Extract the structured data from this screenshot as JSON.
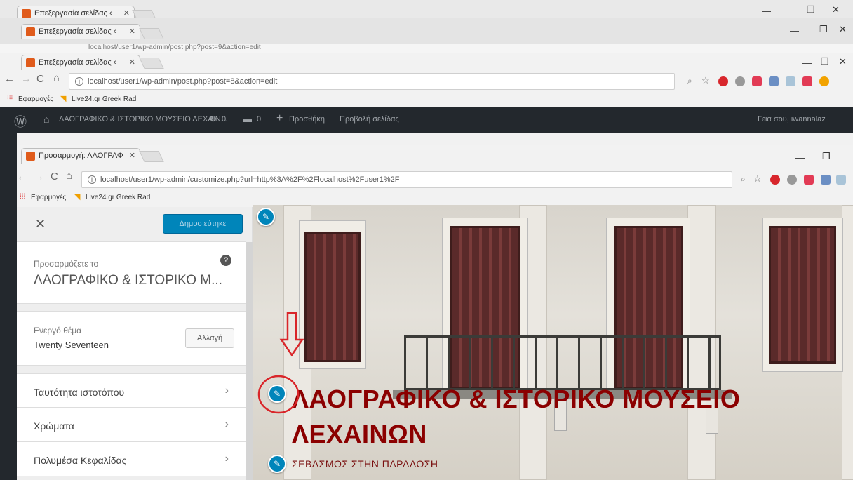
{
  "window_back2": {
    "tab_title": "Επεξεργασία σελίδας ‹",
    "address": "localhost/user1/wp-admin/post.php?post=9&action=edit"
  },
  "window_back1": {
    "tab_title": "Επεξεργασία σελίδας ‹"
  },
  "window_edit": {
    "tab_title": "Επεξεργασία σελίδας ‹",
    "address": "localhost/user1/wp-admin/post.php?post=8&action=edit",
    "bookmarks": {
      "apps": "Εφαρμογές",
      "live24": "Live24.gr Greek Rad"
    }
  },
  "wp_admin_bar": {
    "site_name": "ΛΑΟΓΡΑΦΙΚΟ & ΙΣΤΟΡΙΚΟ ΜΟΥΣΕΙΟ ΛΕΧΑΙΝ...",
    "updates_count": "0",
    "comments_count": "0",
    "new_label": "Προσθήκη",
    "view_label": "Προβολή σελίδας",
    "greeting": "Γεια σου, iwannalaz"
  },
  "window_customize": {
    "tab_title": "Προσαρμογή: ΛΑΟΓΡΑΦ",
    "address": "localhost/user1/wp-admin/customize.php?url=http%3A%2F%2Flocalhost%2Fuser1%2F",
    "bookmarks": {
      "apps": "Εφαρμογές",
      "live24": "Live24.gr Greek Rad"
    }
  },
  "customizer": {
    "publish_label": "Δημοσιεύτηκε",
    "customizing_label": "Προσαρμόζετε το",
    "site_title": "ΛΑΟΓΡΑΦΙΚΟ & ΙΣΤΟΡΙΚΟ Μ...",
    "active_theme_label": "Ενεργό θέμα",
    "theme_name": "Twenty Seventeen",
    "change_button": "Αλλαγή",
    "menu_items": [
      {
        "label": "Ταυτότητα ιστοτόπου"
      },
      {
        "label": "Χρώματα"
      },
      {
        "label": "Πολυμέσα Κεφαλίδας"
      }
    ]
  },
  "preview": {
    "site_title_line1": "ΛΑΟΓΡΑΦΙΚΟ & ΙΣΤΟΡΙΚΟ ΜΟΥΣΕΙΟ",
    "site_title_line2": "ΛΕΧΑΙΝΩΝ",
    "tagline": "ΣΕΒΑΣΜΟΣ ΣΤΗΝ ΠΑΡΑΔΟΣΗ"
  },
  "colors": {
    "wp_blue": "#0085ba",
    "title_red": "#8b0000",
    "annotation_red": "#d9262a",
    "admin_bar": "#23282d"
  },
  "icons": {
    "close": "close-icon",
    "help": "help-icon",
    "edit": "pencil-icon",
    "chevron": "chevron-right-icon",
    "arrow": "down-arrow-annotation"
  }
}
